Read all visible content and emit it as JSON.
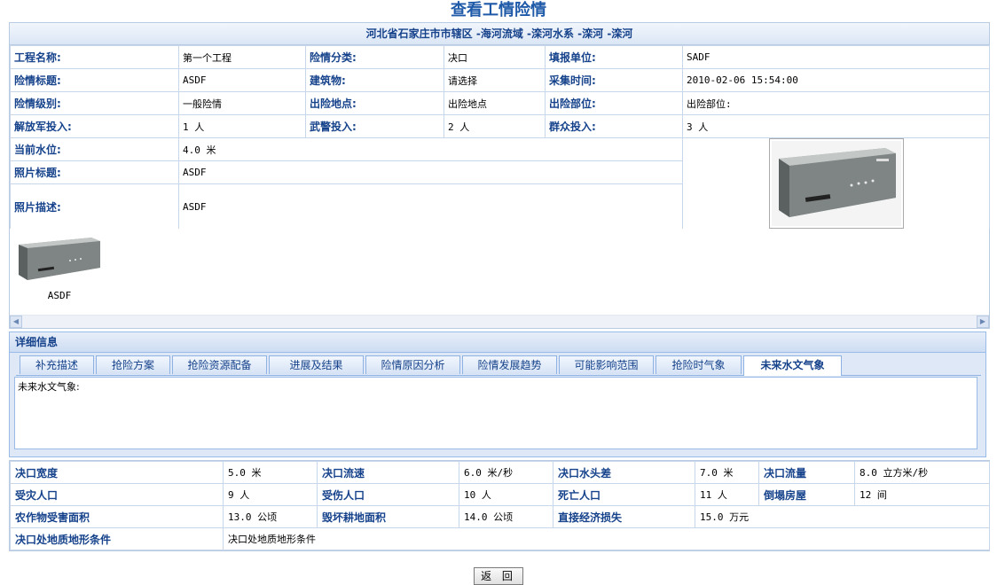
{
  "page_title": "查看工情险情",
  "location": "河北省石家庄市市辖区 -海河流域 -滦河水系 -滦河 -滦河",
  "info": {
    "project_name_label": "工程名称:",
    "project_name": "第一个工程",
    "danger_type_label": "险情分类:",
    "danger_type": "决口",
    "report_unit_label": "填报单位:",
    "report_unit": "SADF",
    "danger_title_label": "险情标题:",
    "danger_title": "ASDF",
    "building_label": "建筑物:",
    "building": "请选择",
    "collect_time_label": "采集时间:",
    "collect_time": "2010-02-06 15:54:00",
    "danger_level_label": "险情级别:",
    "danger_level": "一般险情",
    "danger_place_label": "出险地点:",
    "danger_place": "出险地点",
    "danger_part_label": "出险部位:",
    "danger_part": "出险部位:",
    "pla_label": "解放军投入:",
    "pla": "1 人",
    "police_label": "武警投入:",
    "police": "2 人",
    "masses_label": "群众投入:",
    "masses": "3 人",
    "water_level_label": "当前水位:",
    "water_level": "4.0 米",
    "photo_title_label": "照片标题:",
    "photo_title": "ASDF",
    "photo_desc_label": "照片描述:",
    "photo_desc": "ASDF"
  },
  "thumbnails": [
    {
      "caption": "ASDF"
    }
  ],
  "detail": {
    "header": "详细信息",
    "tabs": [
      "补充描述",
      "抢险方案",
      "抢险资源配备",
      "进展及结果",
      "险情原因分析",
      "险情发展趋势",
      "可能影响范围",
      "抢险时气象",
      "未来水文气象"
    ],
    "active_tab": "未来水文气象",
    "body_text": "未来水文气象:"
  },
  "stats": {
    "breach_width_label": "决口宽度",
    "breach_width": "5.0 米",
    "breach_speed_label": "决口流速",
    "breach_speed": "6.0 米/秒",
    "breach_head_label": "决口水头差",
    "breach_head": "7.0 米",
    "breach_flow_label": "决口流量",
    "breach_flow": "8.0 立方米/秒",
    "affected_pop_label": "受灾人口",
    "affected_pop": "9 人",
    "injured_label": "受伤人口",
    "injured": "10 人",
    "dead_label": "死亡人口",
    "dead": "11 人",
    "collapsed_label": "倒塌房屋",
    "collapsed": "12 间",
    "crop_area_label": "农作物受害面积",
    "crop_area": "13.0 公顷",
    "farmland_label": "毁坏耕地面积",
    "farmland": "14.0 公顷",
    "loss_label": "直接经济损失",
    "loss": "15.0 万元",
    "geology_label": "决口处地质地形条件",
    "geology": "决口处地质地形条件"
  },
  "back_label": "返 回",
  "colors": {
    "label_blue": "#15428b",
    "border": "#c8d6ea",
    "panel": "#dfe8f6"
  }
}
